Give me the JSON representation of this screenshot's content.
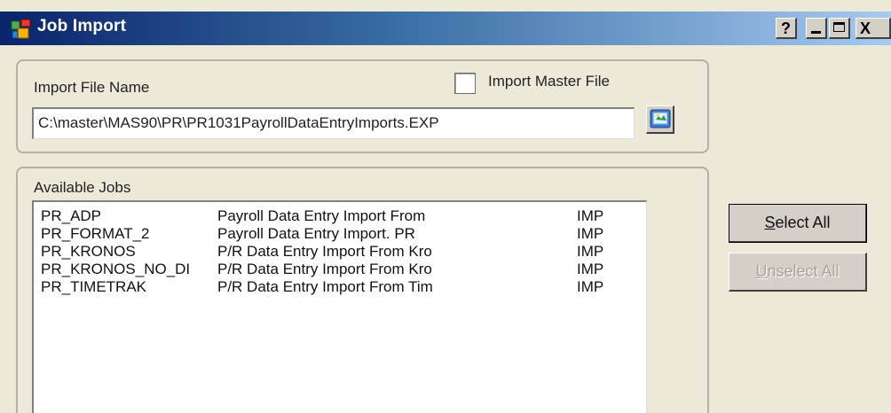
{
  "window": {
    "title": "Job Import",
    "help_label": "?",
    "close_label": "X"
  },
  "file_section": {
    "label": "Import File Name",
    "master_label": "Import Master File",
    "master_checked": false,
    "file_path": "C:\\master\\MAS90\\PR\\PR1031PayrollDataEntryImports.EXP"
  },
  "jobs_section": {
    "label": "Available Jobs",
    "rows": [
      {
        "name": "PR_ADP",
        "description": "Payroll Data Entry Import From",
        "type": "IMP"
      },
      {
        "name": "PR_FORMAT_2",
        "description": "Payroll Data Entry Import.  PR",
        "type": "IMP"
      },
      {
        "name": "PR_KRONOS",
        "description": "P/R Data Entry Import From Kro",
        "type": "IMP"
      },
      {
        "name": "PR_KRONOS_NO_DI",
        "description": "P/R Data Entry Import From Kro",
        "type": "IMP"
      },
      {
        "name": "PR_TIMETRAK",
        "description": "P/R Data Entry Import From Tim",
        "type": "IMP"
      }
    ]
  },
  "buttons": {
    "select_all_first": "S",
    "select_all_rest": "elect All",
    "unselect_all_first": "U",
    "unselect_all_rest": "nselect All"
  },
  "colors": {
    "titlebar_start": "#0a246a",
    "titlebar_end": "#a6caf0",
    "window_bg": "#ece9d8"
  }
}
